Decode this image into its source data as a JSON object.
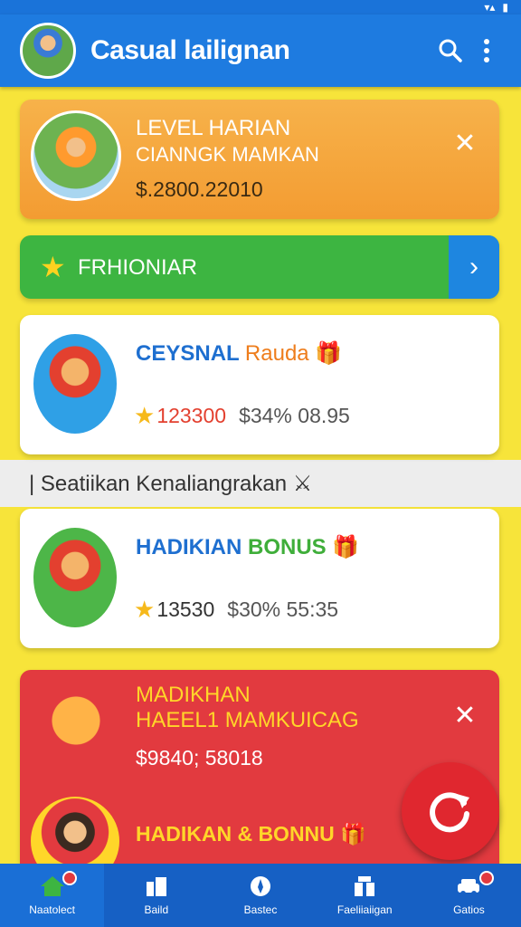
{
  "app": {
    "title": "Casual lailignan",
    "search_icon": "search-icon",
    "menu_icon": "more-vert-icon"
  },
  "level_card": {
    "title": "LEVEL HARIAN",
    "subtitle": "CIANNGK MAMKAN",
    "amount": "$.2800.22010",
    "close": "✕"
  },
  "promo_bar": {
    "label": "FRHIONIAR",
    "arrow": "›"
  },
  "game_cards": [
    {
      "title_a": "CEYSNAL",
      "title_b": "Rauda",
      "points": "123300",
      "money": "$34% 08.95"
    },
    {
      "title_a": "HADIKIAN",
      "title_b": "BONUS",
      "points": "13530",
      "money": "$30% 55:35"
    }
  ],
  "section": {
    "heading": "Seatiikan Kenaliangrakan"
  },
  "red_card": {
    "title_line_1": "MADIKHAN",
    "title_line_2": "HAEEL1 MAMKUICAG",
    "amount": "$9840; 58018",
    "bonus": "HADIKAN & BONNU",
    "close": "✕"
  },
  "bottom_nav": [
    {
      "label": "Naatolect",
      "icon": "home-icon",
      "badge": true
    },
    {
      "label": "Baild",
      "icon": "building-icon",
      "badge": false
    },
    {
      "label": "Bastec",
      "icon": "compass-icon",
      "badge": false
    },
    {
      "label": "Faeliiaiigan",
      "icon": "gift-icon",
      "badge": false
    },
    {
      "label": "Gatios",
      "icon": "car-icon",
      "badge": true
    }
  ],
  "colors": {
    "primary_blue": "#1e7be0",
    "accent_yellow": "#f7e43a",
    "orange": "#f39c32",
    "green": "#3db541",
    "red": "#e23a3f"
  }
}
